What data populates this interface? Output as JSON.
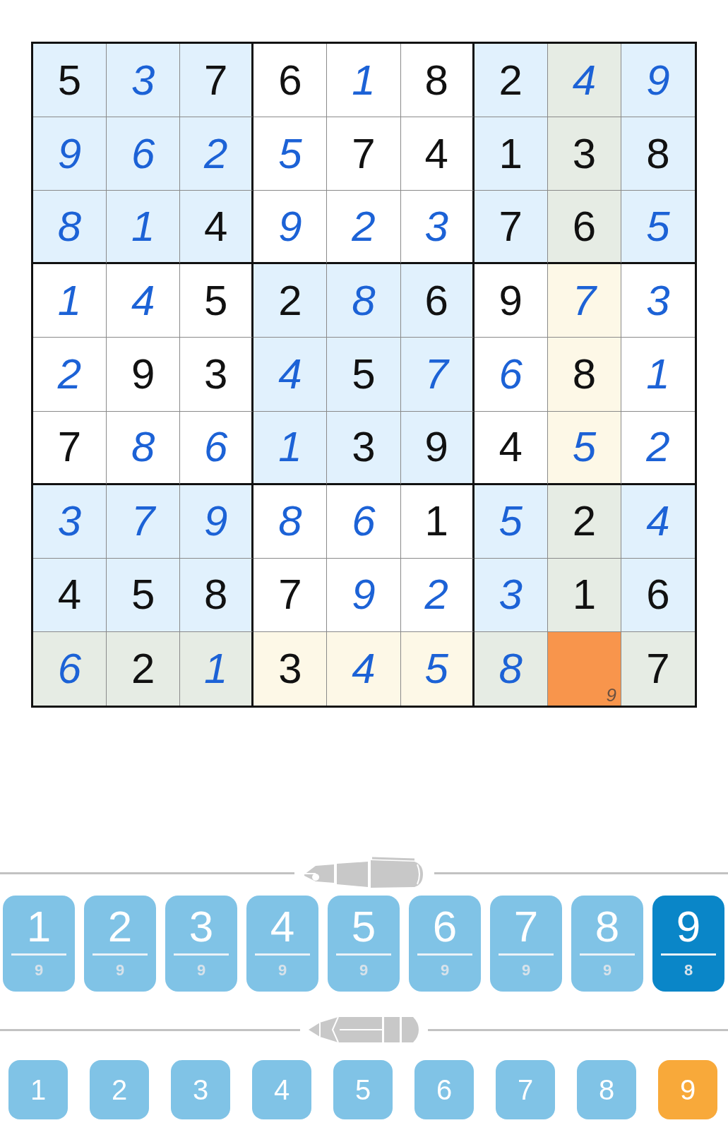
{
  "board": {
    "rows": [
      {
        "cells": [
          {
            "value": "5",
            "kind": "given",
            "color": "#e1f1fd"
          },
          {
            "value": "3",
            "kind": "user",
            "color": "#e1f1fd"
          },
          {
            "value": "7",
            "kind": "given",
            "color": "#e1f1fd"
          },
          {
            "value": "6",
            "kind": "given",
            "color": "#ffffff"
          },
          {
            "value": "1",
            "kind": "user",
            "color": "#ffffff"
          },
          {
            "value": "8",
            "kind": "given",
            "color": "#ffffff"
          },
          {
            "value": "2",
            "kind": "given",
            "color": "#e1f1fd"
          },
          {
            "value": "4",
            "kind": "user",
            "color": "#e6ece4"
          },
          {
            "value": "9",
            "kind": "user",
            "color": "#e1f1fd"
          }
        ]
      },
      {
        "cells": [
          {
            "value": "9",
            "kind": "user",
            "color": "#e1f1fd"
          },
          {
            "value": "6",
            "kind": "user",
            "color": "#e1f1fd"
          },
          {
            "value": "2",
            "kind": "user",
            "color": "#e1f1fd"
          },
          {
            "value": "5",
            "kind": "user",
            "color": "#ffffff"
          },
          {
            "value": "7",
            "kind": "given",
            "color": "#ffffff"
          },
          {
            "value": "4",
            "kind": "given",
            "color": "#ffffff"
          },
          {
            "value": "1",
            "kind": "given",
            "color": "#e1f1fd"
          },
          {
            "value": "3",
            "kind": "given",
            "color": "#e6ece4"
          },
          {
            "value": "8",
            "kind": "given",
            "color": "#e1f1fd"
          }
        ]
      },
      {
        "cells": [
          {
            "value": "8",
            "kind": "user",
            "color": "#e1f1fd"
          },
          {
            "value": "1",
            "kind": "user",
            "color": "#e1f1fd"
          },
          {
            "value": "4",
            "kind": "given",
            "color": "#e1f1fd"
          },
          {
            "value": "9",
            "kind": "user",
            "color": "#ffffff"
          },
          {
            "value": "2",
            "kind": "user",
            "color": "#ffffff"
          },
          {
            "value": "3",
            "kind": "user",
            "color": "#ffffff"
          },
          {
            "value": "7",
            "kind": "given",
            "color": "#e1f1fd"
          },
          {
            "value": "6",
            "kind": "given",
            "color": "#e6ece4"
          },
          {
            "value": "5",
            "kind": "user",
            "color": "#e1f1fd"
          }
        ]
      },
      {
        "cells": [
          {
            "value": "1",
            "kind": "user",
            "color": "#ffffff"
          },
          {
            "value": "4",
            "kind": "user",
            "color": "#ffffff"
          },
          {
            "value": "5",
            "kind": "given",
            "color": "#ffffff"
          },
          {
            "value": "2",
            "kind": "given",
            "color": "#e1f1fd"
          },
          {
            "value": "8",
            "kind": "user",
            "color": "#e1f1fd"
          },
          {
            "value": "6",
            "kind": "given",
            "color": "#e1f1fd"
          },
          {
            "value": "9",
            "kind": "given",
            "color": "#ffffff"
          },
          {
            "value": "7",
            "kind": "user",
            "color": "#fdf8e7"
          },
          {
            "value": "3",
            "kind": "user",
            "color": "#ffffff"
          }
        ]
      },
      {
        "cells": [
          {
            "value": "2",
            "kind": "user",
            "color": "#ffffff"
          },
          {
            "value": "9",
            "kind": "given",
            "color": "#ffffff"
          },
          {
            "value": "3",
            "kind": "given",
            "color": "#ffffff"
          },
          {
            "value": "4",
            "kind": "user",
            "color": "#e1f1fd"
          },
          {
            "value": "5",
            "kind": "given",
            "color": "#e1f1fd"
          },
          {
            "value": "7",
            "kind": "user",
            "color": "#e1f1fd"
          },
          {
            "value": "6",
            "kind": "user",
            "color": "#ffffff"
          },
          {
            "value": "8",
            "kind": "given",
            "color": "#fdf8e7"
          },
          {
            "value": "1",
            "kind": "user",
            "color": "#ffffff"
          }
        ]
      },
      {
        "cells": [
          {
            "value": "7",
            "kind": "given",
            "color": "#ffffff"
          },
          {
            "value": "8",
            "kind": "user",
            "color": "#ffffff"
          },
          {
            "value": "6",
            "kind": "user",
            "color": "#ffffff"
          },
          {
            "value": "1",
            "kind": "user",
            "color": "#e1f1fd"
          },
          {
            "value": "3",
            "kind": "given",
            "color": "#e1f1fd"
          },
          {
            "value": "9",
            "kind": "given",
            "color": "#e1f1fd"
          },
          {
            "value": "4",
            "kind": "given",
            "color": "#ffffff"
          },
          {
            "value": "5",
            "kind": "user",
            "color": "#fdf8e7"
          },
          {
            "value": "2",
            "kind": "user",
            "color": "#ffffff"
          }
        ]
      },
      {
        "cells": [
          {
            "value": "3",
            "kind": "user",
            "color": "#e1f1fd"
          },
          {
            "value": "7",
            "kind": "user",
            "color": "#e1f1fd"
          },
          {
            "value": "9",
            "kind": "user",
            "color": "#e1f1fd"
          },
          {
            "value": "8",
            "kind": "user",
            "color": "#ffffff"
          },
          {
            "value": "6",
            "kind": "user",
            "color": "#ffffff"
          },
          {
            "value": "1",
            "kind": "given",
            "color": "#ffffff"
          },
          {
            "value": "5",
            "kind": "user",
            "color": "#e1f1fd"
          },
          {
            "value": "2",
            "kind": "given",
            "color": "#e6ece4"
          },
          {
            "value": "4",
            "kind": "user",
            "color": "#e1f1fd"
          }
        ]
      },
      {
        "cells": [
          {
            "value": "4",
            "kind": "given",
            "color": "#e1f1fd"
          },
          {
            "value": "5",
            "kind": "given",
            "color": "#e1f1fd"
          },
          {
            "value": "8",
            "kind": "given",
            "color": "#e1f1fd"
          },
          {
            "value": "7",
            "kind": "given",
            "color": "#ffffff"
          },
          {
            "value": "9",
            "kind": "user",
            "color": "#ffffff"
          },
          {
            "value": "2",
            "kind": "user",
            "color": "#ffffff"
          },
          {
            "value": "3",
            "kind": "user",
            "color": "#e1f1fd"
          },
          {
            "value": "1",
            "kind": "given",
            "color": "#e6ece4"
          },
          {
            "value": "6",
            "kind": "given",
            "color": "#e1f1fd"
          }
        ]
      },
      {
        "cells": [
          {
            "value": "6",
            "kind": "user",
            "color": "#e6ece4"
          },
          {
            "value": "2",
            "kind": "given",
            "color": "#e6ece4"
          },
          {
            "value": "1",
            "kind": "user",
            "color": "#e6ece4"
          },
          {
            "value": "3",
            "kind": "given",
            "color": "#fdf8e7"
          },
          {
            "value": "4",
            "kind": "user",
            "color": "#fdf8e7"
          },
          {
            "value": "5",
            "kind": "user",
            "color": "#fdf8e7"
          },
          {
            "value": "8",
            "kind": "user",
            "color": "#e6ece4"
          },
          {
            "kind": "empty",
            "color": "#f8954c",
            "notes": [
              "9"
            ]
          },
          {
            "value": "7",
            "kind": "given",
            "color": "#e6ece4"
          }
        ]
      }
    ]
  },
  "pen_pad": [
    {
      "digit": "1",
      "count": "9",
      "selected": false
    },
    {
      "digit": "2",
      "count": "9",
      "selected": false
    },
    {
      "digit": "3",
      "count": "9",
      "selected": false
    },
    {
      "digit": "4",
      "count": "9",
      "selected": false
    },
    {
      "digit": "5",
      "count": "9",
      "selected": false
    },
    {
      "digit": "6",
      "count": "9",
      "selected": false
    },
    {
      "digit": "7",
      "count": "9",
      "selected": false
    },
    {
      "digit": "8",
      "count": "9",
      "selected": false
    },
    {
      "digit": "9",
      "count": "8",
      "selected": true
    }
  ],
  "pencil_pad": [
    {
      "digit": "1",
      "selected": false
    },
    {
      "digit": "2",
      "selected": false
    },
    {
      "digit": "3",
      "selected": false
    },
    {
      "digit": "4",
      "selected": false
    },
    {
      "digit": "5",
      "selected": false
    },
    {
      "digit": "6",
      "selected": false
    },
    {
      "digit": "7",
      "selected": false
    },
    {
      "digit": "8",
      "selected": false
    },
    {
      "digit": "9",
      "selected": true
    }
  ]
}
